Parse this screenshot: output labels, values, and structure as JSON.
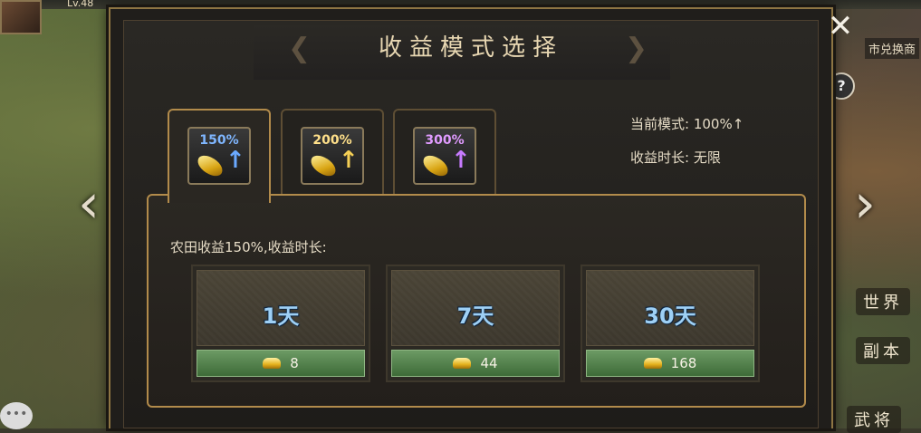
{
  "hud": {
    "level": "Lv.48",
    "top_right_tag": "市兑换商",
    "side_buttons": [
      "世界",
      "副本",
      "武将"
    ]
  },
  "modal": {
    "title": "收益模式选择",
    "tabs": [
      {
        "label": "150%",
        "color": "#7fb6ff",
        "active": true
      },
      {
        "label": "200%",
        "color": "#ffe08a",
        "active": false
      },
      {
        "label": "300%",
        "color": "#e09bff",
        "active": false
      }
    ],
    "current_mode_label": "当前模式: 100%↑",
    "duration_label": "收益时长: 无限",
    "description": "农田收益150%,收益时长:",
    "options": [
      {
        "days": "1天",
        "price": "8"
      },
      {
        "days": "7天",
        "price": "44"
      },
      {
        "days": "30天",
        "price": "168"
      }
    ]
  },
  "icons": {
    "close": "close-icon",
    "help": "help-icon",
    "nav_left": "chevron-left-icon",
    "nav_right": "chevron-right-icon",
    "gold": "gold-ingot-icon"
  }
}
